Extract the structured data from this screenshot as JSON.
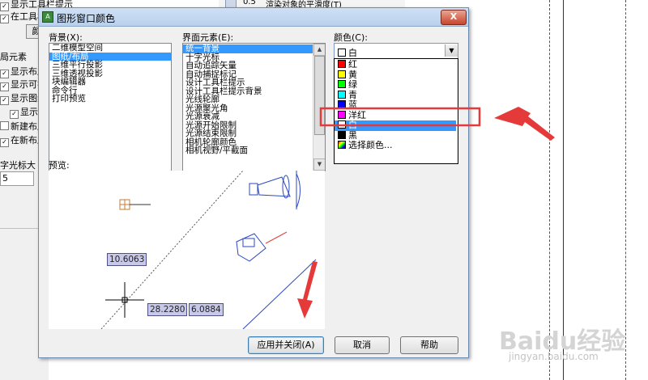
{
  "background": {
    "rows": [
      "显示工具栏提示",
      "在工具栏",
      "颜",
      "局元素",
      "显示布局",
      "显示可打",
      "显示图纸",
      "显示",
      "新建布局",
      "在新布局",
      "字光标大"
    ],
    "field_value": "5",
    "top_value": "0.5",
    "top_text": "渲染对象的平滑度(T)"
  },
  "dialog": {
    "title": "图形窗口颜色",
    "close_label": "X",
    "context": {
      "label": "背景(X):",
      "items": [
        "二维模型空间",
        "图纸/布局",
        "三维平行投影",
        "三维透视投影",
        "块编辑器",
        "命令行",
        "打印预览"
      ],
      "selected_index": 1
    },
    "interface": {
      "label": "界面元素(E):",
      "items": [
        "统一背景",
        "十字光标",
        "自动追踪矢量",
        "自动捕捉标记",
        "设计工具栏提示",
        "设计工具栏提示背景",
        "光线轮廓",
        "光源聚光角",
        "光源衰减",
        "光源开始限制",
        "光源结束限制",
        "相机轮廓颜色",
        "相机视野/平截面"
      ],
      "selected_index": 0
    },
    "color": {
      "label": "颜色(C):",
      "current": "白",
      "options": [
        {
          "name": "红",
          "color": "#ff0000"
        },
        {
          "name": "黄",
          "color": "#ffff00"
        },
        {
          "name": "绿",
          "color": "#00ff00"
        },
        {
          "name": "青",
          "color": "#00ffff"
        },
        {
          "name": "蓝",
          "color": "#0000ff"
        },
        {
          "name": "洋红",
          "color": "#ff00ff"
        },
        {
          "name": "白",
          "color": "#ffffff"
        },
        {
          "name": "黑",
          "color": "#000000"
        },
        {
          "name": "选择颜色...",
          "color": "multicolor"
        }
      ],
      "selected_index": 6
    },
    "preview": {
      "label": "预览:",
      "dim1": "10.6063",
      "dim2": "28.2280",
      "dim3": "6.0884"
    },
    "buttons": {
      "apply": "应用并关闭(A)",
      "cancel": "取消",
      "help": "帮助"
    }
  },
  "watermark": {
    "brand": "Baidu经验",
    "url": "jingyan.baidu.com"
  }
}
